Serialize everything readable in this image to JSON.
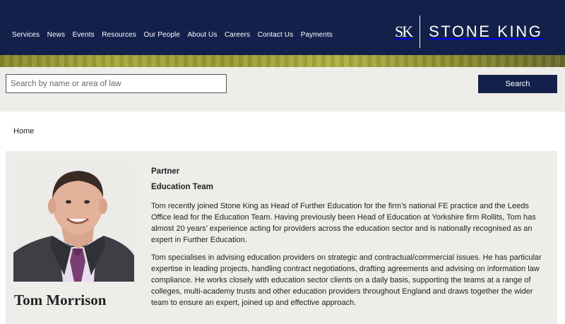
{
  "header": {
    "nav": [
      "Services",
      "News",
      "Events",
      "Resources",
      "Our People",
      "About Us",
      "Careers",
      "Contact Us",
      "Payments"
    ],
    "logo_mark": "SK",
    "logo_name": "STONE KING"
  },
  "search": {
    "placeholder": "Search by name or area of law",
    "button_label": "Search"
  },
  "breadcrumb": {
    "home": "Home"
  },
  "profile": {
    "name": "Tom Morrison",
    "role": "Partner",
    "team": "Education Team",
    "bio": [
      "Tom recently joined Stone King as Head of Further Education for the firm’s national FE practice and the Leeds Office lead for the Education Team. Having previously been Head of Education at Yorkshire firm Rollits, Tom has almost 20 years’ experience acting for providers across the education sector and is nationally recognised as an expert in Further Education.",
      "Tom specialises in advising education providers on strategic and contractual/commercial issues. He has particular expertise in leading projects, handling contract negotiations, drafting agreements and advising on information law compliance. He works closely with education sector clients on a daily basis, supporting the teams at a range of colleges, multi-academy trusts and other education providers throughout England and draws together the wider team to ensure an expert, joined up and effective approach."
    ]
  },
  "colors": {
    "navy": "#13214a",
    "panel": "#efedea"
  }
}
